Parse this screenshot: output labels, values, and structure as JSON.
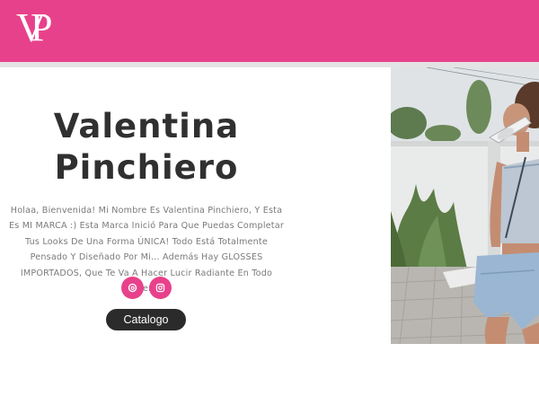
{
  "brand": {
    "logo_text": "VP",
    "accent": "#e8418b",
    "header_shadow": "#e3e3e3"
  },
  "hero": {
    "title_line1": "Valentina",
    "title_line2": "Pinchiero",
    "intro": "Holaa, Bienvenida! Mi Nombre Es Valentina Pinchiero, Y Esta Es MI MARCA :) Esta Marca Inició Para Que Puedas Completar Tus Looks De Una Forma ÚNICA! Todo Está Totalmente Pensado Y Diseñado Por Mi... Además Hay GLOSSES IMPORTADOS, Que Te Va A Hacer Lucir Radiante En Todo Momento...",
    "title_color": "#303030",
    "text_color": "#7a7a7a"
  },
  "social": [
    {
      "icon": "threads-icon"
    },
    {
      "icon": "instagram-icon"
    }
  ],
  "cta": {
    "label": "Catalogo",
    "color": "#2b2b2b"
  },
  "photo": {
    "icon": "person-photo"
  }
}
